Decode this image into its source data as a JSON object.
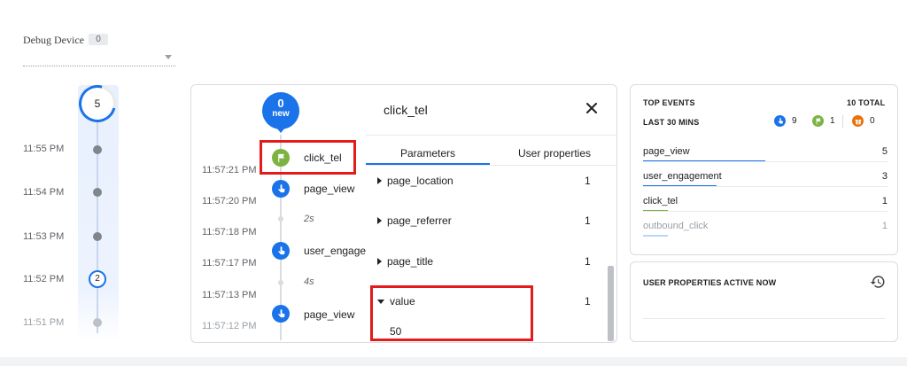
{
  "debug_device": {
    "label": "Debug Device",
    "count": "0"
  },
  "minutes": {
    "top_count": "5",
    "rows": [
      {
        "time": "11:55 PM"
      },
      {
        "time": "11:54 PM"
      },
      {
        "time": "11:53 PM"
      },
      {
        "time": "11:52 PM",
        "badge": "2"
      },
      {
        "time": "11:51 PM"
      }
    ]
  },
  "seconds": {
    "new_count": "0",
    "new_label": "new",
    "timestamps": [
      "11:57:21 PM",
      "11:57:20 PM",
      "11:57:18 PM",
      "11:57:17 PM",
      "11:57:13 PM",
      "11:57:12 PM"
    ],
    "events": [
      {
        "name": "click_tel",
        "icon": "flag-icon",
        "color": "#7cb342"
      },
      {
        "name": "page_view",
        "icon": "touch-icon",
        "color": "#1a73e8"
      },
      {
        "name": "user_engagement",
        "icon": "touch-icon",
        "color": "#1a73e8"
      },
      {
        "name": "page_view",
        "icon": "touch-icon",
        "color": "#1a73e8"
      }
    ],
    "gaps": [
      "2s",
      "4s"
    ]
  },
  "detail": {
    "title": "click_tel",
    "tabs": [
      "Parameters",
      "User properties"
    ],
    "params": [
      {
        "name": "page_location",
        "count": "1"
      },
      {
        "name": "page_referrer",
        "count": "1"
      },
      {
        "name": "page_title",
        "count": "1"
      },
      {
        "name": "value",
        "count": "1",
        "expanded_value": "50"
      }
    ]
  },
  "top_events": {
    "title": "TOP EVENTS",
    "total": "10 TOTAL",
    "period": "LAST 30 MINS",
    "legend": [
      {
        "icon": "touch-icon",
        "count": "9",
        "color": "#1a73e8"
      },
      {
        "icon": "flag-icon",
        "count": "1",
        "color": "#7cb342"
      },
      {
        "icon": "gift-icon",
        "count": "0",
        "color": "#e8710a"
      }
    ],
    "rows": [
      {
        "name": "page_view",
        "count": "5",
        "fraction": 0.5,
        "color": "#1a73e8"
      },
      {
        "name": "user_engagement",
        "count": "3",
        "fraction": 0.3,
        "color": "#1a73e8"
      },
      {
        "name": "click_tel",
        "count": "1",
        "fraction": 0.1,
        "color": "#7cb342"
      },
      {
        "name": "outbound_click",
        "count": "1",
        "fraction": 0.1,
        "color": "#1a73e8"
      }
    ]
  },
  "user_properties": {
    "title": "USER PROPERTIES ACTIVE NOW",
    "icon": "history-icon"
  },
  "colors": {
    "accent": "#1a73e8",
    "highlight": "#e21b1b",
    "conversion": "#7cb342"
  }
}
